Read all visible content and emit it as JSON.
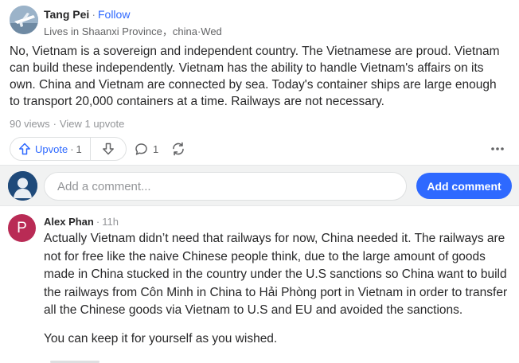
{
  "post": {
    "author": {
      "name": "Tang Pei",
      "separator": "·",
      "follow_label": "Follow",
      "credential": "Lives in Shaanxi Province，china",
      "time": "Wed"
    },
    "body": "No, Vietnam is a sovereign and independent country. The Vietnamese are proud. Vietnam can build these independently. Vietnam has the ability to handle Vietnam's affairs on its own. China and Vietnam are connected by sea. Today's container ships are large enough to transport 20,000 containers at a time. Railways are not necessary.",
    "stats": {
      "views": "90 views",
      "upvotes_link": "View 1 upvote"
    },
    "actions": {
      "upvote_label": "Upvote",
      "upvote_count": "1",
      "comment_count": "1"
    },
    "icons": {
      "upvote": "arrow-up-icon",
      "downvote": "arrow-down-icon",
      "comment": "comment-bubble-icon",
      "share": "share-refresh-icon",
      "more": "more-dots-icon"
    }
  },
  "comment_box": {
    "placeholder": "Add a comment...",
    "button_label": "Add comment"
  },
  "comment": {
    "avatar_letter": "P",
    "author": "Alex Phan",
    "time": "11h",
    "paragraphs": [
      "Actually Vietnam didn’t need that railways for now, China needed it. The railways are not for free like the naive Chinese people think, due to the large amount of goods made in China stucked in the country under the U.S sanctions so China want to build the railways from Côn Minh in China to Hải Phòng port in Vietnam in order to transfer all the Chinese goods via Vietnam to U.S and EU and avoided the sanctions.",
      "You can keep it for yourself as you wished."
    ]
  },
  "colors": {
    "accent": "#2e69ff",
    "comment_avatar": "#b92b55",
    "muted_text": "#939598"
  }
}
